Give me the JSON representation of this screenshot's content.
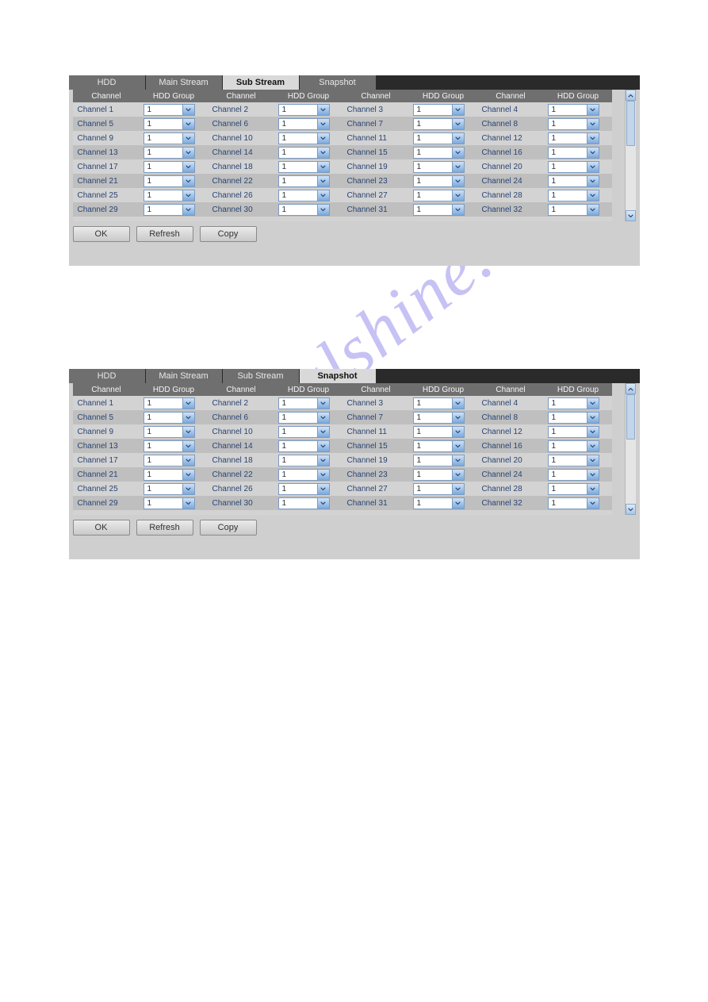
{
  "watermark": "manualshine.com",
  "panels": [
    {
      "active_tab": "sub",
      "tabs": {
        "hdd": "HDD",
        "main": "Main Stream",
        "sub": "Sub Stream",
        "snap": "Snapshot"
      },
      "headers": {
        "channel": "Channel",
        "hdd_group": "HDD Group"
      },
      "buttons": {
        "ok": "OK",
        "refresh": "Refresh",
        "copy": "Copy"
      },
      "rows": [
        [
          {
            "label": "Channel 1",
            "val": "1"
          },
          {
            "label": "Channel 2",
            "val": "1"
          },
          {
            "label": "Channel 3",
            "val": "1"
          },
          {
            "label": "Channel 4",
            "val": "1"
          }
        ],
        [
          {
            "label": "Channel 5",
            "val": "1"
          },
          {
            "label": "Channel 6",
            "val": "1"
          },
          {
            "label": "Channel 7",
            "val": "1"
          },
          {
            "label": "Channel 8",
            "val": "1"
          }
        ],
        [
          {
            "label": "Channel 9",
            "val": "1"
          },
          {
            "label": "Channel 10",
            "val": "1"
          },
          {
            "label": "Channel 11",
            "val": "1"
          },
          {
            "label": "Channel 12",
            "val": "1"
          }
        ],
        [
          {
            "label": "Channel 13",
            "val": "1"
          },
          {
            "label": "Channel 14",
            "val": "1"
          },
          {
            "label": "Channel 15",
            "val": "1"
          },
          {
            "label": "Channel 16",
            "val": "1"
          }
        ],
        [
          {
            "label": "Channel 17",
            "val": "1"
          },
          {
            "label": "Channel 18",
            "val": "1"
          },
          {
            "label": "Channel 19",
            "val": "1"
          },
          {
            "label": "Channel 20",
            "val": "1"
          }
        ],
        [
          {
            "label": "Channel 21",
            "val": "1"
          },
          {
            "label": "Channel 22",
            "val": "1"
          },
          {
            "label": "Channel 23",
            "val": "1"
          },
          {
            "label": "Channel 24",
            "val": "1"
          }
        ],
        [
          {
            "label": "Channel 25",
            "val": "1"
          },
          {
            "label": "Channel 26",
            "val": "1"
          },
          {
            "label": "Channel 27",
            "val": "1"
          },
          {
            "label": "Channel 28",
            "val": "1"
          }
        ],
        [
          {
            "label": "Channel 29",
            "val": "1"
          },
          {
            "label": "Channel 30",
            "val": "1"
          },
          {
            "label": "Channel 31",
            "val": "1"
          },
          {
            "label": "Channel 32",
            "val": "1"
          }
        ]
      ]
    },
    {
      "active_tab": "snap",
      "tabs": {
        "hdd": "HDD",
        "main": "Main Stream",
        "sub": "Sub Stream",
        "snap": "Snapshot"
      },
      "headers": {
        "channel": "Channel",
        "hdd_group": "HDD Group"
      },
      "buttons": {
        "ok": "OK",
        "refresh": "Refresh",
        "copy": "Copy"
      },
      "rows": [
        [
          {
            "label": "Channel 1",
            "val": "1"
          },
          {
            "label": "Channel 2",
            "val": "1"
          },
          {
            "label": "Channel 3",
            "val": "1"
          },
          {
            "label": "Channel 4",
            "val": "1"
          }
        ],
        [
          {
            "label": "Channel 5",
            "val": "1"
          },
          {
            "label": "Channel 6",
            "val": "1"
          },
          {
            "label": "Channel 7",
            "val": "1"
          },
          {
            "label": "Channel 8",
            "val": "1"
          }
        ],
        [
          {
            "label": "Channel 9",
            "val": "1"
          },
          {
            "label": "Channel 10",
            "val": "1"
          },
          {
            "label": "Channel 11",
            "val": "1"
          },
          {
            "label": "Channel 12",
            "val": "1"
          }
        ],
        [
          {
            "label": "Channel 13",
            "val": "1"
          },
          {
            "label": "Channel 14",
            "val": "1"
          },
          {
            "label": "Channel 15",
            "val": "1"
          },
          {
            "label": "Channel 16",
            "val": "1"
          }
        ],
        [
          {
            "label": "Channel 17",
            "val": "1"
          },
          {
            "label": "Channel 18",
            "val": "1"
          },
          {
            "label": "Channel 19",
            "val": "1"
          },
          {
            "label": "Channel 20",
            "val": "1"
          }
        ],
        [
          {
            "label": "Channel 21",
            "val": "1"
          },
          {
            "label": "Channel 22",
            "val": "1"
          },
          {
            "label": "Channel 23",
            "val": "1"
          },
          {
            "label": "Channel 24",
            "val": "1"
          }
        ],
        [
          {
            "label": "Channel 25",
            "val": "1"
          },
          {
            "label": "Channel 26",
            "val": "1"
          },
          {
            "label": "Channel 27",
            "val": "1"
          },
          {
            "label": "Channel 28",
            "val": "1"
          }
        ],
        [
          {
            "label": "Channel 29",
            "val": "1"
          },
          {
            "label": "Channel 30",
            "val": "1"
          },
          {
            "label": "Channel 31",
            "val": "1"
          },
          {
            "label": "Channel 32",
            "val": "1"
          }
        ]
      ]
    }
  ]
}
